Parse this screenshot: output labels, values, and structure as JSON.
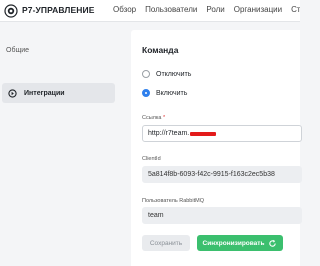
{
  "header": {
    "brand": "Р7-УПРАВЛЕНИЕ",
    "nav": [
      "Обзор",
      "Пользователи",
      "Роли",
      "Организации",
      "Статистика"
    ]
  },
  "sidebar": {
    "section": "Общие",
    "items": [
      {
        "label": "Интеграции",
        "icon": "integration-icon",
        "active": true
      }
    ]
  },
  "main": {
    "title": "Команда",
    "options": [
      {
        "label": "Отключить",
        "checked": false
      },
      {
        "label": "Включить",
        "checked": true
      }
    ],
    "link": {
      "label": "Ссылка",
      "required_mark": "*",
      "value": "http://r7team."
    },
    "client_id": {
      "label": "ClientId",
      "value": "5a814f8b-6093-f42c-9915-f163c2ec5b38"
    },
    "rabbit_user": {
      "label": "Пользователь RabbitMQ",
      "value": "team"
    },
    "buttons": {
      "save": "Сохранить",
      "sync": "Синхронизировать"
    }
  },
  "colors": {
    "accent": "#2f80ed",
    "sync_button": "#3bbf6e",
    "redaction": "#e31b1b"
  }
}
